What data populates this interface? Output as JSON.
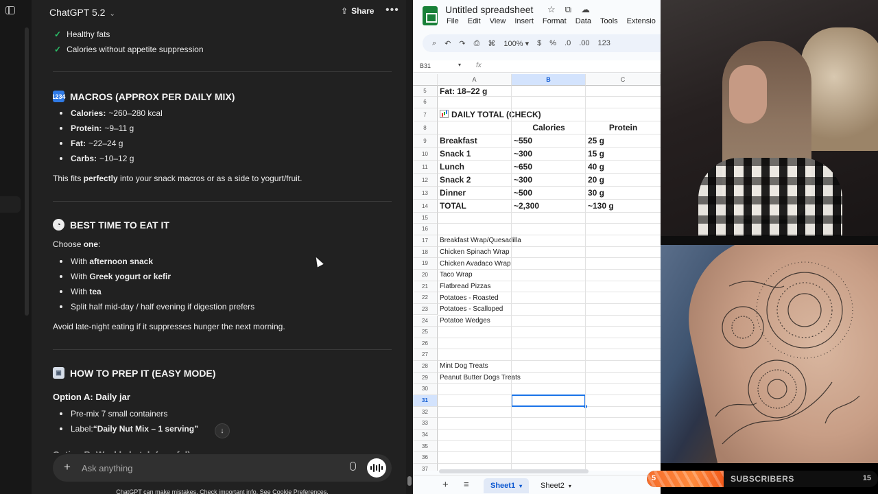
{
  "chat": {
    "model": "ChatGPT 5.2",
    "share_label": "Share",
    "checks": [
      "Healthy fats",
      "Calories without appetite suppression"
    ],
    "macros": {
      "heading": "MACROS (APPROX PER DAILY MIX)",
      "items": [
        {
          "label": "Calories:",
          "value": "~260–280 kcal"
        },
        {
          "label": "Protein:",
          "value": "~9–11 g"
        },
        {
          "label": "Fat:",
          "value": "~22–24 g"
        },
        {
          "label": "Carbs:",
          "value": "~10–12 g"
        }
      ],
      "note_pre": "This fits ",
      "note_bold": "perfectly",
      "note_post": " into your snack macros or as a side to yogurt/fruit."
    },
    "best_time": {
      "heading": "BEST TIME TO EAT IT",
      "choose_pre": "Choose ",
      "choose_bold": "one",
      "choose_post": ":",
      "items": [
        {
          "pre": "With ",
          "bold": "afternoon snack"
        },
        {
          "pre": "With ",
          "bold": "Greek yogurt or kefir"
        },
        {
          "pre": "With ",
          "bold": "tea"
        },
        {
          "pre": "Split half mid-day / half evening if digestion prefers",
          "bold": ""
        }
      ],
      "note": "Avoid late-night eating if it suppresses hunger the next morning."
    },
    "prep": {
      "heading": "HOW TO PREP IT (EASY MODE)",
      "option_a": "Option A: Daily jar",
      "items": [
        {
          "pre": "Pre-mix 7 small containers",
          "bold": ""
        },
        {
          "pre": "Label: ",
          "bold": "“Daily Nut Mix – 1 serving”"
        }
      ],
      "option_b": "Option B: Weekly batch (careful)"
    },
    "composer_placeholder": "Ask anything",
    "disclaimer": "ChatGPT can make mistakes. Check important info. See Cookie Preferences."
  },
  "sheets": {
    "title": "Untitled spreadsheet",
    "menu": [
      "File",
      "Edit",
      "View",
      "Insert",
      "Format",
      "Data",
      "Tools",
      "Extensio"
    ],
    "zoom": "100%",
    "toolbar_text": [
      "$",
      "%",
      ".0",
      ".00",
      "123"
    ],
    "cell_ref": "B31",
    "fx": "fx",
    "columns": [
      "A",
      "B",
      "C"
    ],
    "rows": [
      {
        "n": "5",
        "a": "Fat: 18–22 g",
        "b": "",
        "c": "",
        "style": "bold"
      },
      {
        "n": "6",
        "a": "",
        "b": "",
        "c": "",
        "style": ""
      },
      {
        "n": "7",
        "a": "DAILY TOTAL (CHECK)",
        "b": "",
        "c": "",
        "style": "title"
      },
      {
        "n": "8",
        "a": "",
        "b": "Calories",
        "c": "Protein",
        "style": "hdr"
      },
      {
        "n": "9",
        "a": "Breakfast",
        "b": "~550",
        "c": "25 g",
        "style": "bold"
      },
      {
        "n": "10",
        "a": "Snack 1",
        "b": "~300",
        "c": "15 g",
        "style": "bold"
      },
      {
        "n": "11",
        "a": "Lunch",
        "b": "~650",
        "c": "40 g",
        "style": "bold"
      },
      {
        "n": "12",
        "a": "Snack 2",
        "b": "~300",
        "c": "20 g",
        "style": "bold"
      },
      {
        "n": "13",
        "a": "Dinner",
        "b": "~500",
        "c": "30 g",
        "style": "bold"
      },
      {
        "n": "14",
        "a": "TOTAL",
        "b": "~2,300",
        "c": "~130 g",
        "style": "boldplain"
      },
      {
        "n": "15",
        "a": "",
        "b": "",
        "c": "",
        "style": ""
      },
      {
        "n": "16",
        "a": "",
        "b": "",
        "c": "",
        "style": ""
      },
      {
        "n": "17",
        "a": "Breakfast Wrap/Quesadilla",
        "b": "",
        "c": "",
        "style": "small"
      },
      {
        "n": "18",
        "a": "Chicken Spinach Wrap",
        "b": "",
        "c": "",
        "style": "small"
      },
      {
        "n": "19",
        "a": "Chicken Avadaco Wrap",
        "b": "",
        "c": "",
        "style": "small"
      },
      {
        "n": "20",
        "a": "Taco Wrap",
        "b": "",
        "c": "",
        "style": "small"
      },
      {
        "n": "21",
        "a": "Flatbread Pizzas",
        "b": "",
        "c": "",
        "style": "small"
      },
      {
        "n": "22",
        "a": "Potatoes - Roasted",
        "b": "",
        "c": "",
        "style": "small"
      },
      {
        "n": "23",
        "a": "Potatoes - Scalloped",
        "b": "",
        "c": "",
        "style": "small"
      },
      {
        "n": "24",
        "a": "Potatoe Wedges",
        "b": "",
        "c": "",
        "style": "small"
      },
      {
        "n": "25",
        "a": "",
        "b": "",
        "c": "",
        "style": ""
      },
      {
        "n": "26",
        "a": "",
        "b": "",
        "c": "",
        "style": ""
      },
      {
        "n": "27",
        "a": "",
        "b": "",
        "c": "",
        "style": ""
      },
      {
        "n": "28",
        "a": "Mint Dog Treats",
        "b": "",
        "c": "",
        "style": "small"
      },
      {
        "n": "29",
        "a": "Peanut Butter Dogs Treats",
        "b": "",
        "c": "",
        "style": "small"
      },
      {
        "n": "30",
        "a": "",
        "b": "",
        "c": "",
        "style": ""
      },
      {
        "n": "31",
        "a": "",
        "b": "",
        "c": "",
        "style": "selected"
      },
      {
        "n": "32",
        "a": "",
        "b": "",
        "c": "",
        "style": ""
      },
      {
        "n": "33",
        "a": "",
        "b": "",
        "c": "",
        "style": ""
      },
      {
        "n": "34",
        "a": "",
        "b": "",
        "c": "",
        "style": ""
      },
      {
        "n": "35",
        "a": "",
        "b": "",
        "c": "",
        "style": ""
      },
      {
        "n": "36",
        "a": "",
        "b": "",
        "c": "",
        "style": ""
      },
      {
        "n": "37",
        "a": "",
        "b": "",
        "c": "",
        "style": ""
      }
    ],
    "tabs": [
      "Sheet1",
      "Sheet2"
    ]
  },
  "stream": {
    "subs_current": "5",
    "subs_label": "SUBSCRIBERS",
    "subs_goal": "15",
    "subs_fraction": 0.333
  }
}
